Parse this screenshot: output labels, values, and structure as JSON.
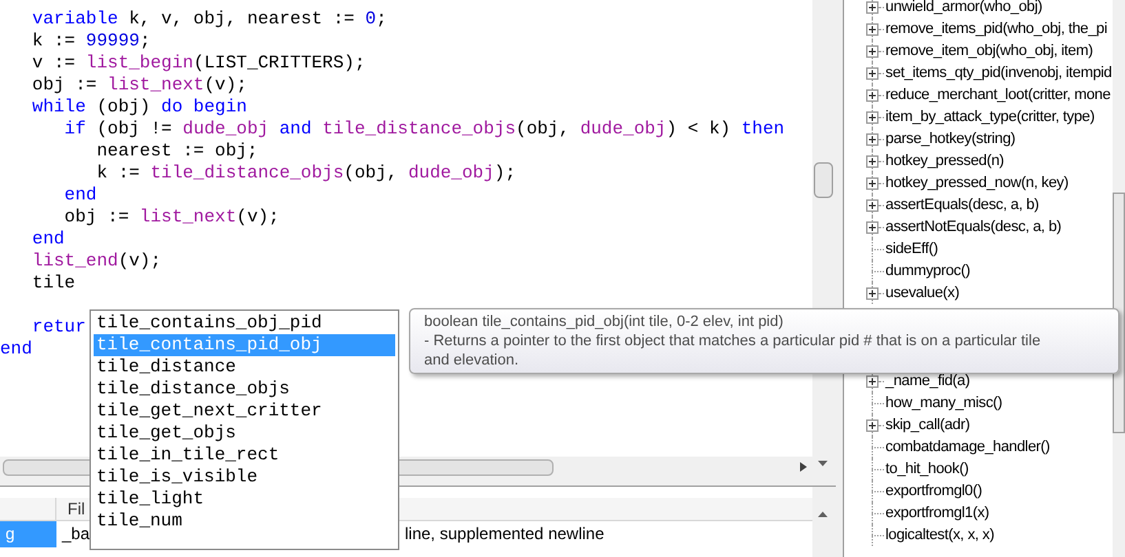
{
  "editor": {
    "lines": [
      {
        "tokens": [
          {
            "text": "   variable",
            "kind": "keyword"
          },
          {
            "text": " k, v, obj, nearest := ",
            "kind": "plain"
          },
          {
            "text": "0",
            "kind": "number"
          },
          {
            "text": ";",
            "kind": "plain"
          }
        ]
      },
      {
        "tokens": [
          {
            "text": "   k := ",
            "kind": "plain"
          },
          {
            "text": "99999",
            "kind": "number"
          },
          {
            "text": ";",
            "kind": "plain"
          }
        ]
      },
      {
        "tokens": [
          {
            "text": "   v := ",
            "kind": "plain"
          },
          {
            "text": "list_begin",
            "kind": "function"
          },
          {
            "text": "(LIST_CRITTERS);",
            "kind": "plain"
          }
        ]
      },
      {
        "tokens": [
          {
            "text": "   obj := ",
            "kind": "plain"
          },
          {
            "text": "list_next",
            "kind": "function"
          },
          {
            "text": "(v);",
            "kind": "plain"
          }
        ]
      },
      {
        "tokens": [
          {
            "text": "   while",
            "kind": "keyword"
          },
          {
            "text": " (obj) ",
            "kind": "plain"
          },
          {
            "text": "do begin",
            "kind": "keyword"
          }
        ]
      },
      {
        "tokens": [
          {
            "text": "      if",
            "kind": "keyword"
          },
          {
            "text": " (obj != ",
            "kind": "plain"
          },
          {
            "text": "dude_obj",
            "kind": "function"
          },
          {
            "text": " and ",
            "kind": "keyword"
          },
          {
            "text": "tile_distance_objs",
            "kind": "function"
          },
          {
            "text": "(obj, ",
            "kind": "plain"
          },
          {
            "text": "dude_obj",
            "kind": "function"
          },
          {
            "text": ") < k) ",
            "kind": "plain"
          },
          {
            "text": "then",
            "kind": "keyword"
          }
        ]
      },
      {
        "tokens": [
          {
            "text": "         nearest := obj;",
            "kind": "plain"
          }
        ]
      },
      {
        "tokens": [
          {
            "text": "         k := ",
            "kind": "plain"
          },
          {
            "text": "tile_distance_objs",
            "kind": "function"
          },
          {
            "text": "(obj, ",
            "kind": "plain"
          },
          {
            "text": "dude_obj",
            "kind": "function"
          },
          {
            "text": ");",
            "kind": "plain"
          }
        ]
      },
      {
        "tokens": [
          {
            "text": "      end",
            "kind": "keyword"
          }
        ]
      },
      {
        "tokens": [
          {
            "text": "      obj := ",
            "kind": "plain"
          },
          {
            "text": "list_next",
            "kind": "function"
          },
          {
            "text": "(v);",
            "kind": "plain"
          }
        ]
      },
      {
        "tokens": [
          {
            "text": "   end",
            "kind": "keyword"
          }
        ]
      },
      {
        "tokens": [
          {
            "text": "   list_end",
            "kind": "function"
          },
          {
            "text": "(v);",
            "kind": "plain"
          }
        ]
      },
      {
        "tokens": [
          {
            "text": "   tile",
            "kind": "plain"
          }
        ]
      },
      {
        "kind": "blank"
      },
      {
        "tokens": [
          {
            "text": "   retur",
            "kind": "keyword"
          }
        ]
      },
      {
        "tokens": [
          {
            "text": "end",
            "kind": "keyword"
          }
        ]
      }
    ]
  },
  "autocomplete": {
    "items": [
      {
        "label": "tile_contains_obj_pid",
        "selected": false
      },
      {
        "label": "tile_contains_pid_obj",
        "selected": true
      },
      {
        "label": "tile_distance",
        "selected": false
      },
      {
        "label": "tile_distance_objs",
        "selected": false
      },
      {
        "label": "tile_get_next_critter",
        "selected": false
      },
      {
        "label": "tile_get_objs",
        "selected": false
      },
      {
        "label": "tile_in_tile_rect",
        "selected": false
      },
      {
        "label": "tile_is_visible",
        "selected": false
      },
      {
        "label": "tile_light",
        "selected": false
      },
      {
        "label": "tile_num",
        "selected": false
      }
    ]
  },
  "tooltip": {
    "signature": "boolean tile_contains_pid_obj(int tile, 0-2 elev, int pid)",
    "description": " - Returns a pointer to the first object that matches a particular pid # that is on a particular tile and elevation."
  },
  "messages": {
    "header": "Fil",
    "row": [
      {
        "text": "g",
        "selected": true
      },
      {
        "text": "_ba",
        "selected": false
      },
      {
        "text": "line, supplemented newline",
        "selected": false
      }
    ]
  },
  "tree": {
    "items_above": [
      {
        "label": "unwield_armor(who_obj)",
        "expandable": true
      },
      {
        "label": "remove_items_pid(who_obj, the_pi",
        "expandable": true
      },
      {
        "label": "remove_item_obj(who_obj, item)",
        "expandable": true
      },
      {
        "label": "set_items_qty_pid(invenobj, itempid",
        "expandable": true
      },
      {
        "label": "reduce_merchant_loot(critter, mone",
        "expandable": true
      },
      {
        "label": "item_by_attack_type(critter, type)",
        "expandable": true
      },
      {
        "label": "parse_hotkey(string)",
        "expandable": true
      },
      {
        "label": "hotkey_pressed(n)",
        "expandable": true
      },
      {
        "label": "hotkey_pressed_now(n, key)",
        "expandable": true
      },
      {
        "label": "assertEquals(desc, a, b)",
        "expandable": true
      },
      {
        "label": "assertNotEquals(desc, a, b)",
        "expandable": true
      },
      {
        "label": "sideEff()",
        "expandable": false
      },
      {
        "label": "dummyproc()",
        "expandable": false
      },
      {
        "label": "usevalue(x)",
        "expandable": true
      }
    ],
    "items_below": [
      {
        "label": "_name_fid(a)",
        "expandable": true
      },
      {
        "label": "how_many_misc()",
        "expandable": false
      },
      {
        "label": "skip_call(adr)",
        "expandable": true
      },
      {
        "label": "combatdamage_handler()",
        "expandable": false
      },
      {
        "label": "to_hit_hook()",
        "expandable": false
      },
      {
        "label": "exportfromgl0()",
        "expandable": false
      },
      {
        "label": "exportfromgl1(x)",
        "expandable": false
      },
      {
        "label": "logicaltest(x, x, x)",
        "expandable": false
      }
    ]
  }
}
